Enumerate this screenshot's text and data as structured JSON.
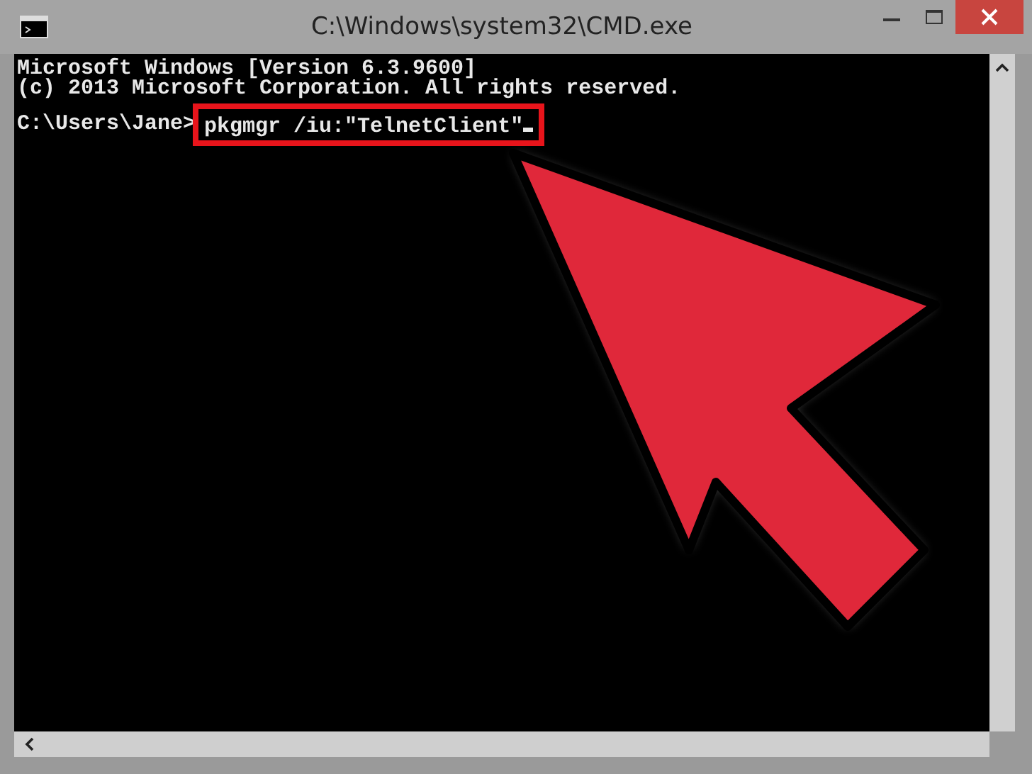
{
  "window": {
    "title": "C:\\Windows\\system32\\CMD.exe"
  },
  "console": {
    "lines": [
      "Microsoft Windows [Version 6.3.9600]",
      "(c) 2013 Microsoft Corporation. All rights reserved."
    ],
    "prompt": "C:\\Users\\Jane>",
    "command": "pkgmgr /iu:\"TelnetClient\"",
    "highlighted": true
  }
}
